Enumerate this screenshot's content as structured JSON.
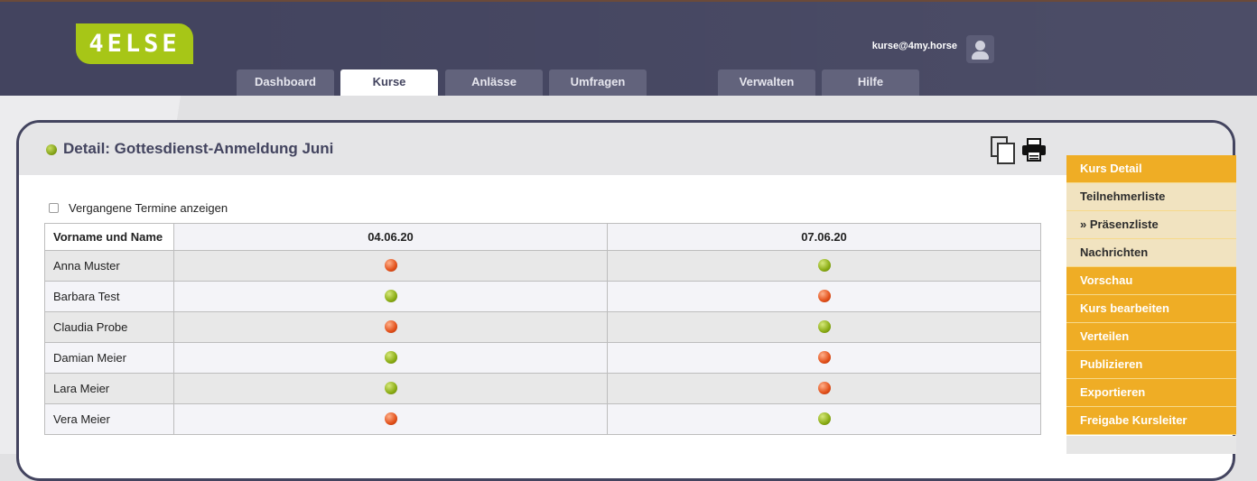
{
  "header": {
    "logo_text": "4ELSE",
    "user_email": "kurse@4my.horse",
    "tabs": [
      {
        "label": "Dashboard",
        "active": false
      },
      {
        "label": "Kurse",
        "active": true
      },
      {
        "label": "Anlässe",
        "active": false
      },
      {
        "label": "Umfragen",
        "active": false
      },
      {
        "label": "Verwalten",
        "active": false
      },
      {
        "label": "Hilfe",
        "active": false
      }
    ]
  },
  "detail": {
    "title": "Detail: Gottesdienst-Anmeldung Juni",
    "show_past_label": "Vergangene Termine anzeigen",
    "show_past_checked": false
  },
  "table": {
    "columns": [
      "Vorname und Name",
      "04.06.20",
      "07.06.20"
    ],
    "rows": [
      {
        "name": "Anna Muster",
        "status": [
          "red",
          "green"
        ]
      },
      {
        "name": "Barbara Test",
        "status": [
          "green",
          "red"
        ]
      },
      {
        "name": "Claudia Probe",
        "status": [
          "red",
          "green"
        ]
      },
      {
        "name": "Damian Meier",
        "status": [
          "green",
          "red"
        ]
      },
      {
        "name": "Lara Meier",
        "status": [
          "green",
          "red"
        ]
      },
      {
        "name": "Vera Meier",
        "status": [
          "red",
          "green"
        ]
      }
    ]
  },
  "sidemenu": {
    "items": [
      {
        "label": "Kurs Detail",
        "style": "orange"
      },
      {
        "label": "Teilnehmerliste",
        "style": "beige"
      },
      {
        "label": "» Präsenzliste",
        "style": "current"
      },
      {
        "label": "Nachrichten",
        "style": "beige"
      },
      {
        "label": "Vorschau",
        "style": "orange"
      },
      {
        "label": "Kurs bearbeiten",
        "style": "orange"
      },
      {
        "label": "Verteilen",
        "style": "orange"
      },
      {
        "label": "Publizieren",
        "style": "orange"
      },
      {
        "label": "Exportieren",
        "style": "orange"
      },
      {
        "label": "Freigabe Kursleiter",
        "style": "orange"
      }
    ]
  },
  "colors": {
    "header_bg": "#43445f",
    "accent_orange": "#efad25",
    "logo_green": "#a7c617",
    "status_green": "#8aac14",
    "status_red": "#e2501a"
  },
  "icons": [
    "copy-icon",
    "print-icon",
    "user-icon",
    "status-dot-icon"
  ]
}
